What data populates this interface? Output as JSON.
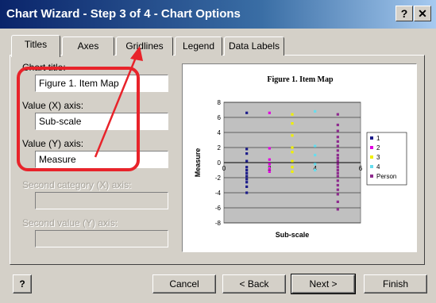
{
  "window": {
    "title": "Chart Wizard - Step 3 of 4 - Chart Options",
    "help_glyph": "?",
    "close_glyph": "✕"
  },
  "tabs": [
    {
      "label": "Titles"
    },
    {
      "label": "Axes"
    },
    {
      "label": "Gridlines"
    },
    {
      "label": "Legend"
    },
    {
      "label": "Data Labels"
    }
  ],
  "fields": {
    "chart_title": {
      "label": "Chart title:",
      "value": "Figure 1. Item Map"
    },
    "x_axis": {
      "label": "Value (X) axis:",
      "value": "Sub-scale"
    },
    "y_axis": {
      "label": "Value (Y) axis:",
      "value": "Measure"
    },
    "second_x": {
      "label": "Second category (X) axis:",
      "value": ""
    },
    "second_y": {
      "label": "Second value (Y) axis:",
      "value": ""
    }
  },
  "buttons": {
    "help": "?",
    "cancel": "Cancel",
    "back": "< Back",
    "next": "Next >",
    "finish": "Finish"
  },
  "colors": {
    "annotation": "#e8232a",
    "plot_area": "#c0c0c0"
  },
  "chart_data": {
    "type": "scatter",
    "title": "Figure 1. Item Map",
    "xlabel": "Sub-scale",
    "ylabel": "Measure",
    "xlim": [
      0,
      6
    ],
    "ylim": [
      -8,
      8
    ],
    "xticks": [
      0,
      2,
      4,
      6
    ],
    "yticks": [
      8,
      6,
      4,
      2,
      0,
      -2,
      -4,
      -6,
      -8
    ],
    "grid": true,
    "legend_position": "right",
    "series": [
      {
        "name": "1",
        "color": "#1c1c8a",
        "x": [
          1,
          1,
          1,
          1,
          1,
          1,
          1,
          1,
          1,
          1,
          1,
          1
        ],
        "y": [
          6.6,
          1.8,
          1.2,
          0.2,
          -0.6,
          -1.0,
          -1.4,
          -1.8,
          -2.2,
          -2.6,
          -3.2,
          -4.0
        ]
      },
      {
        "name": "2",
        "color": "#e000e0",
        "x": [
          2,
          2,
          2,
          2,
          2,
          2
        ],
        "y": [
          6.6,
          1.9,
          0.4,
          -0.2,
          -0.8,
          -1.2
        ]
      },
      {
        "name": "3",
        "color": "#f0f000",
        "x": [
          3,
          3,
          3,
          3,
          3,
          3,
          3,
          3
        ],
        "y": [
          6.4,
          5.2,
          3.6,
          2.0,
          1.4,
          0.2,
          -0.6,
          -1.2
        ]
      },
      {
        "name": "4",
        "color": "#66ddee",
        "x": [
          4,
          4,
          4,
          4,
          4
        ],
        "y": [
          6.8,
          2.2,
          1.0,
          -0.2,
          -1.0
        ]
      },
      {
        "name": "Person",
        "color": "#8e2b8e",
        "x": [
          5,
          5,
          5,
          5,
          5,
          5,
          5,
          5,
          5,
          5,
          5,
          5,
          5,
          5,
          5,
          5,
          5,
          5,
          5,
          5,
          5
        ],
        "y": [
          6.4,
          5.0,
          4.2,
          3.4,
          2.8,
          2.2,
          1.6,
          1.0,
          0.6,
          0.2,
          -0.2,
          -0.6,
          -1.0,
          -1.4,
          -1.8,
          -2.4,
          -3.0,
          -3.6,
          -4.2,
          -5.2,
          -6.2
        ]
      }
    ]
  }
}
